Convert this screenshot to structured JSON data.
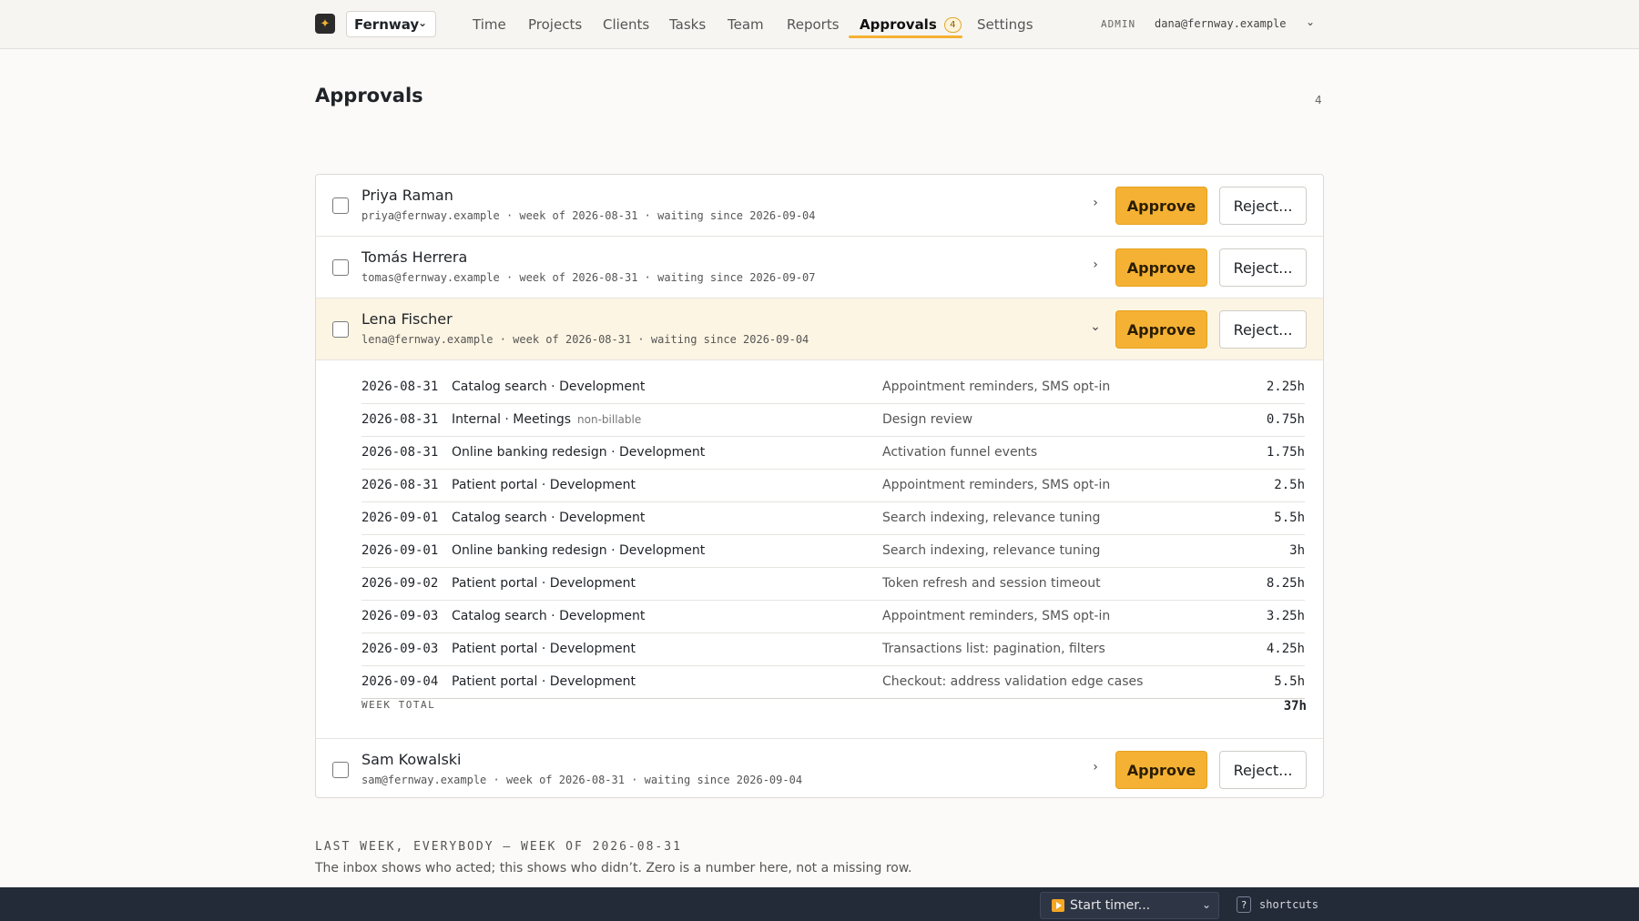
{
  "nav": {
    "org": "Fernway",
    "items": [
      {
        "label": "Time"
      },
      {
        "label": "Projects"
      },
      {
        "label": "Clients"
      },
      {
        "label": "Tasks"
      },
      {
        "label": "Team"
      },
      {
        "label": "Reports"
      },
      {
        "label": "Approvals",
        "badge": "4",
        "active": true
      },
      {
        "label": "Settings"
      }
    ],
    "role": "ADMIN",
    "user": "dana@fernway.example"
  },
  "page": {
    "title": "Approvals",
    "count": "4"
  },
  "approvals": [
    {
      "name": "Priya Raman",
      "email": "priya@fernway.example",
      "week": "week of 2026-08-31",
      "waiting": "waiting since 2026-09-04",
      "meta": "priya@fernway.example · week of 2026-08-31 · waiting since 2026-09-04"
    },
    {
      "name": "Tomás Herrera",
      "email": "tomas@fernway.example",
      "week": "week of 2026-08-31",
      "waiting": "waiting since 2026-09-07",
      "meta": "tomas@fernway.example · week of 2026-08-31 · waiting since 2026-09-07"
    },
    {
      "name": "Lena Fischer",
      "email": "lena@fernway.example",
      "week": "week of 2026-08-31",
      "waiting": "waiting since 2026-09-04",
      "meta": "lena@fernway.example · week of 2026-08-31 · waiting since 2026-09-04",
      "expanded": true
    },
    {
      "name": "Sam Kowalski",
      "email": "sam@fernway.example",
      "week": "week of 2026-08-31",
      "waiting": "waiting since 2026-09-04",
      "meta": "sam@fernway.example · week of 2026-08-31 · waiting since 2026-09-04"
    }
  ],
  "actions": {
    "approve": "Approve",
    "reject": "Reject..."
  },
  "entries": [
    {
      "date": "2026-08-31",
      "project": "Catalog search · Development",
      "note": "",
      "desc": "Appointment reminders, SMS opt-in",
      "hours": "2.25h"
    },
    {
      "date": "2026-08-31",
      "project": "Internal · Meetings",
      "note": "non-billable",
      "desc": "Design review",
      "hours": "0.75h"
    },
    {
      "date": "2026-08-31",
      "project": "Online banking redesign · Development",
      "note": "",
      "desc": "Activation funnel events",
      "hours": "1.75h"
    },
    {
      "date": "2026-08-31",
      "project": "Patient portal · Development",
      "note": "",
      "desc": "Appointment reminders, SMS opt-in",
      "hours": "2.5h"
    },
    {
      "date": "2026-09-01",
      "project": "Catalog search · Development",
      "note": "",
      "desc": "Search indexing, relevance tuning",
      "hours": "5.5h"
    },
    {
      "date": "2026-09-01",
      "project": "Online banking redesign · Development",
      "note": "",
      "desc": "Search indexing, relevance tuning",
      "hours": "3h"
    },
    {
      "date": "2026-09-02",
      "project": "Patient portal · Development",
      "note": "",
      "desc": "Token refresh and session timeout",
      "hours": "8.25h"
    },
    {
      "date": "2026-09-03",
      "project": "Catalog search · Development",
      "note": "",
      "desc": "Appointment reminders, SMS opt-in",
      "hours": "3.25h"
    },
    {
      "date": "2026-09-03",
      "project": "Patient portal · Development",
      "note": "",
      "desc": "Transactions list: pagination, filters",
      "hours": "4.25h"
    },
    {
      "date": "2026-09-04",
      "project": "Patient portal · Development",
      "note": "",
      "desc": "Checkout: address validation edge cases",
      "hours": "5.5h"
    }
  ],
  "total": {
    "label": "WEEK TOTAL",
    "value": "37h"
  },
  "section": {
    "label": "LAST WEEK, EVERYBODY — WEEK OF 2026-08-31",
    "sub": "The inbox shows who acted; this shows who didn’t. Zero is a number here, not a missing row."
  },
  "footer": {
    "timer": "Start timer...",
    "kbd": "?",
    "shortcuts": "shortcuts"
  },
  "icons": {
    "logo": "feather-logo-icon",
    "collapsed": "chevron-right-icon",
    "expanded": "chevron-down-icon"
  },
  "colors": {
    "accent": "#f5b133",
    "expanded_row": "#fdf5e3",
    "footer": "#232a38"
  }
}
